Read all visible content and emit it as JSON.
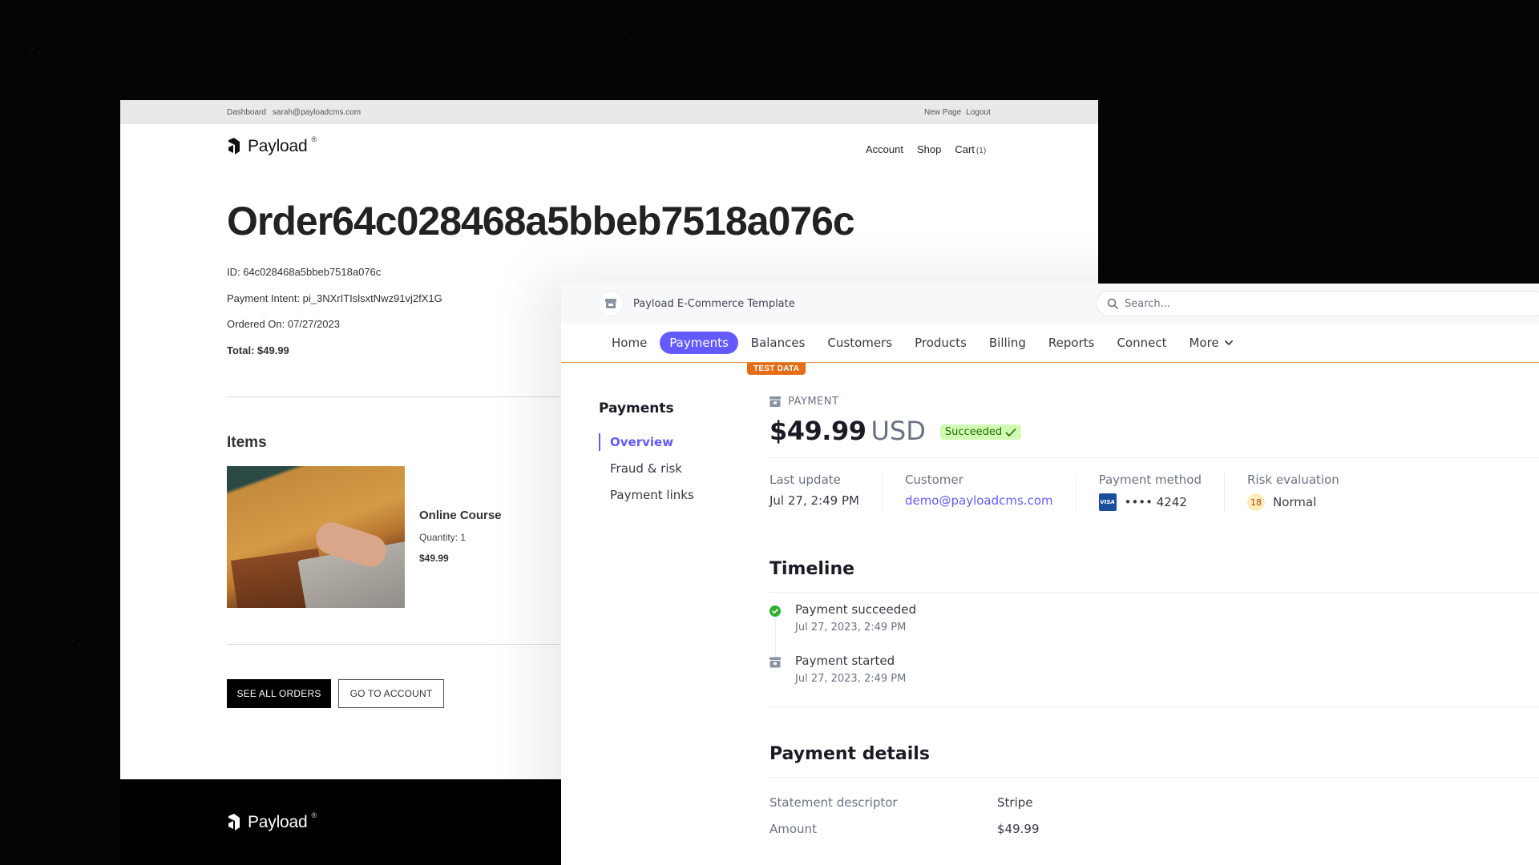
{
  "storefront": {
    "topbar": {
      "left_links": [
        "Dashboard",
        "sarah@payloadcms.com"
      ],
      "right_links": [
        "New Page",
        "Logout"
      ]
    },
    "logo_text": "Payload",
    "logo_sup": "®",
    "nav": {
      "account": "Account",
      "shop": "Shop",
      "cart": "Cart",
      "cart_count": "(1)"
    },
    "order_title": "Order64c028468a5bbeb7518a076c",
    "meta": {
      "id": "ID: 64c028468a5bbeb7518a076c",
      "payment_intent": "Payment Intent: pi_3NXrITIslsxtNwz91vj2fX1G",
      "ordered_on": "Ordered On: 07/27/2023",
      "total": "Total: $49.99"
    },
    "items_title": "Items",
    "items": [
      {
        "name": "Online Course",
        "quantity": "Quantity: 1",
        "price": "$49.99"
      }
    ],
    "buttons": {
      "see_all_orders": "SEE ALL ORDERS",
      "go_to_account": "GO TO ACCOUNT"
    },
    "footer_logo_text": "Payload",
    "footer_logo_sup": "®"
  },
  "stripe": {
    "account_name": "Payload E-Commerce Template",
    "search_placeholder": "Search...",
    "nav": [
      {
        "label": "Home",
        "active": false
      },
      {
        "label": "Payments",
        "active": true
      },
      {
        "label": "Balances",
        "active": false
      },
      {
        "label": "Customers",
        "active": false
      },
      {
        "label": "Products",
        "active": false
      },
      {
        "label": "Billing",
        "active": false
      },
      {
        "label": "Reports",
        "active": false
      },
      {
        "label": "Connect",
        "active": false
      },
      {
        "label": "More",
        "active": false
      }
    ],
    "test_badge": "TEST DATA",
    "sidebar": {
      "title": "Payments",
      "items": [
        "Overview",
        "Fraud & risk",
        "Payment links"
      ],
      "active_index": 0
    },
    "payment": {
      "label": "PAYMENT",
      "amount": "$49.99",
      "currency": "USD",
      "status": "Succeeded",
      "summary": {
        "last_update_label": "Last update",
        "last_update": "Jul 27, 2:49 PM",
        "customer_label": "Customer",
        "customer": "demo@payloadcms.com",
        "payment_method_label": "Payment method",
        "card_brand": "VISA",
        "card_last4": "•••• 4242",
        "risk_label": "Risk evaluation",
        "risk_score": "18",
        "risk_level": "Normal"
      }
    },
    "timeline": {
      "title": "Timeline",
      "events": [
        {
          "title": "Payment succeeded",
          "time": "Jul 27, 2023, 2:49 PM",
          "icon": "check-circle-icon"
        },
        {
          "title": "Payment started",
          "time": "Jul 27, 2023, 2:49 PM",
          "icon": "payment-icon"
        }
      ]
    },
    "details": {
      "title": "Payment details",
      "rows": [
        {
          "key": "Statement descriptor",
          "value": "Stripe"
        },
        {
          "key": "Amount",
          "value": "$49.99"
        }
      ]
    }
  },
  "colors": {
    "stripe_accent": "#635bff",
    "test_mode_orange": "#e46d15",
    "success_bg": "#d1fab3",
    "success_text": "#217005"
  }
}
